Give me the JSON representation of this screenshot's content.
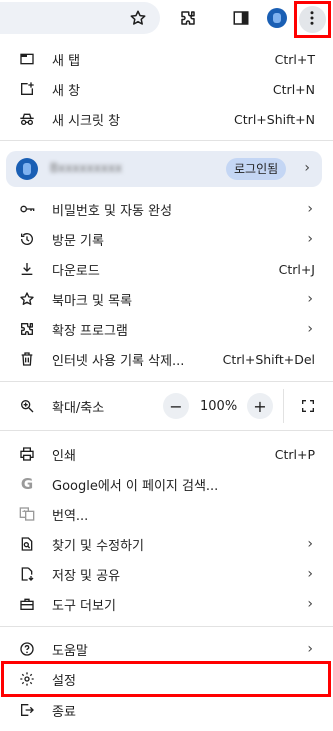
{
  "toolbar": {
    "icons": [
      "star-icon",
      "extensions-icon",
      "side-panel-icon",
      "profile-avatar-icon",
      "more-vert-icon"
    ]
  },
  "menu": {
    "new_tab": {
      "label": "새 탭",
      "shortcut": "Ctrl+T",
      "icon": "new-tab-icon"
    },
    "new_window": {
      "label": "새 창",
      "shortcut": "Ctrl+N",
      "icon": "new-window-icon"
    },
    "new_incognito": {
      "label": "새 시크릿 창",
      "shortcut": "Ctrl+Shift+N",
      "icon": "incognito-icon"
    },
    "profile": {
      "name": "Bxxxxxxxxx",
      "signin_label": "로그인됨"
    },
    "passwords": {
      "label": "비밀번호 및 자동 완성",
      "icon": "key-icon"
    },
    "history": {
      "label": "방문 기록",
      "icon": "history-icon"
    },
    "downloads": {
      "label": "다운로드",
      "shortcut": "Ctrl+J",
      "icon": "download-icon"
    },
    "bookmarks": {
      "label": "북마크 및 목록",
      "icon": "star-icon"
    },
    "extensions": {
      "label": "확장 프로그램",
      "icon": "extensions-icon"
    },
    "clear_data": {
      "label": "인터넷 사용 기록 삭제...",
      "shortcut": "Ctrl+Shift+Del",
      "icon": "trash-icon"
    },
    "zoom": {
      "label": "확대/축소",
      "minus": "−",
      "value": "100%",
      "plus": "+",
      "icon": "zoom-icon"
    },
    "print": {
      "label": "인쇄",
      "shortcut": "Ctrl+P",
      "icon": "print-icon"
    },
    "google_search": {
      "label": "Google에서 이 페이지 검색...",
      "icon": "google-icon"
    },
    "translate": {
      "label": "번역...",
      "icon": "translate-icon"
    },
    "find_edit": {
      "label": "찾기 및 수정하기",
      "icon": "find-icon"
    },
    "save_share": {
      "label": "저장 및 공유",
      "icon": "save-share-icon"
    },
    "more_tools": {
      "label": "도구 더보기",
      "icon": "toolbox-icon"
    },
    "help": {
      "label": "도움말",
      "icon": "help-icon"
    },
    "settings": {
      "label": "설정",
      "icon": "gear-icon"
    },
    "exit": {
      "label": "종료",
      "icon": "exit-icon"
    }
  },
  "colors": {
    "highlight": "#ff0000",
    "profile_card_bg": "#e7ecf5",
    "signin_chip_bg": "#c4d6f4",
    "avatar": "#1a5fb4"
  }
}
